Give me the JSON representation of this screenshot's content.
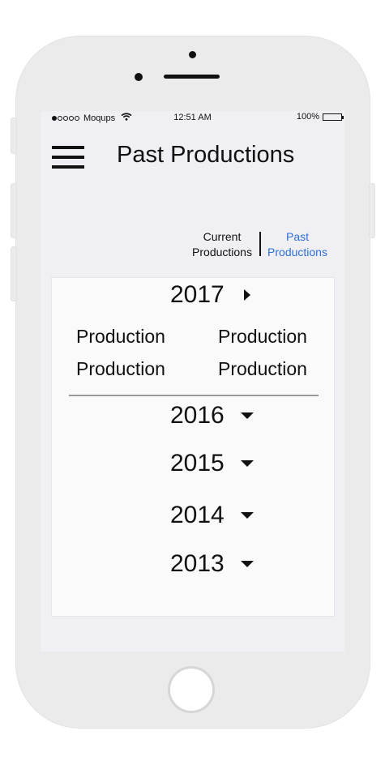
{
  "status_bar": {
    "carrier": "Moqups",
    "time": "12:51 AM",
    "battery": "100%",
    "signal_dots_filled": 1,
    "signal_dots_total": 5
  },
  "header": {
    "title": "Past Productions",
    "menu_icon": "hamburger-menu-icon"
  },
  "segments": {
    "current_line1": "Current",
    "current_line2": "Productions",
    "past_line1": "Past",
    "past_line2": "Productions",
    "active": "past",
    "active_color": "#2f6fd6"
  },
  "years": [
    {
      "label": "2017",
      "expanded": true,
      "productions": [
        "Production",
        "Production",
        "Production",
        "Production"
      ]
    },
    {
      "label": "2016",
      "expanded": false
    },
    {
      "label": "2015",
      "expanded": false
    },
    {
      "label": "2014",
      "expanded": false
    },
    {
      "label": "2013",
      "expanded": false
    }
  ]
}
